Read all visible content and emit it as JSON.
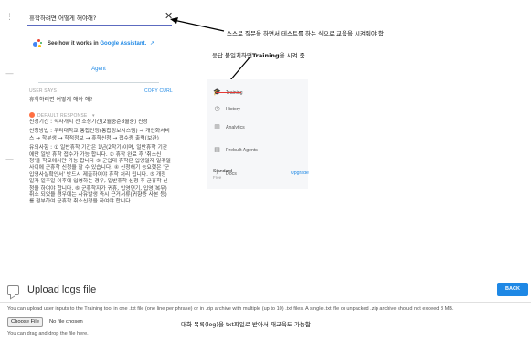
{
  "console": {
    "query": "휴학하려면 어떻게 해야해?",
    "assistant_prefix": "See how it works in",
    "assistant_link": "Google Assistant.",
    "assistant_ext": "↗",
    "tab_label": "Agent",
    "user_says_label": "USER SAYS",
    "copy_curl_label": "COPY CURL",
    "user_says_text": "휴학하려면 어떻게 해야 해?",
    "default_response_label": "DEFAULT RESPONSE",
    "default_response_caret": "▾",
    "response_paragraphs": [
      "신청기간 : 학사개시 전 소정기간(2월중순8월중) 신청",
      "신청방법 : 우리대학교 통합인정(통합정보시스템) → 개인화서비스 → 학부생 → 학적정보 → 휴학신청 → 접수증 출력(보관)",
      "유의사항 : ① 일반휴학 기간은 1년(2학기)이며, 일반휴학 기간에만 일반 휴학 접수가 가능 합니다. ② 휴학 완료 후 '취소신청'을 학교에서만 가능 합니다 ③ 군입대 휴학은 입영일자 일주일 사이에 군휴학 신청을 할 수 있습니다. ④ 신청해기 능요했은 '군입영사실확인서' 반드시 제출하여야 휴학 처리 됩니다. ⑤ 개정 일자 일주일 이후에 입영하는 경우, 일반휴학 신청 후 군휴학 신청을 하여야 합니다. ⑥ 군휴학자가 귀휴, 입영연기, 입영(복무)취소 되었을 경우에는 사유발생 즉시 근거서류(귀향증 사본 등)를 첨부하여 군휴학 취소신청을 하여야 합니다."
    ]
  },
  "annotations": {
    "top": "스스로 질문을 하면서 테스트를 하는 식으로 교육을 시켜줘야 함",
    "middle_prefix": "응답 불일치하면",
    "middle_bold": "Training",
    "middle_suffix": "을 시켜 줌",
    "bottom": "대화 목록(log)을 txt파일로 받아서 재교육도 가능함"
  },
  "sidebar": {
    "items": [
      {
        "icon": "graduation-cap-icon",
        "glyph": "🎓",
        "label": "Training"
      },
      {
        "icon": "clock-icon",
        "glyph": "◷",
        "label": "History"
      },
      {
        "icon": "bar-chart-icon",
        "glyph": "▥",
        "label": "Analytics"
      },
      {
        "icon": "prebuilt-agents-icon",
        "glyph": "▤",
        "label": "Prebuilt Agents"
      },
      {
        "icon": "chevron-right-icon",
        "glyph": "›",
        "label": "Docs"
      }
    ],
    "plan_name": "Standard",
    "plan_tier": "Free",
    "upgrade_label": "Upgrade"
  },
  "upload": {
    "title": "Upload logs file",
    "back_label": "BACK",
    "description": "You can upload user inputs to the Training tool in one .txt file (one line per phrase) or in .zip archive with multiple (up to 10) .txt files. A single .txt file or unpacked .zip archive should not exceed 3 MB.",
    "choose_file_label": "Choose File",
    "no_file_label": "No file chosen",
    "drag_hint": "You can drag and drop the file here."
  },
  "colors": {
    "accent": "#1e88e5",
    "training_underline": "#e53935",
    "response_dot": "#ff7043"
  }
}
